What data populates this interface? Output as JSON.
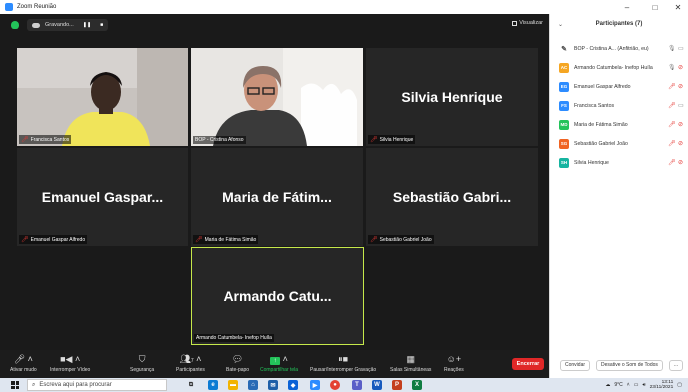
{
  "window": {
    "title": "Zoom Reunião",
    "controls": [
      "–",
      "□",
      "✕"
    ]
  },
  "topbar": {
    "recording": "Gravando...",
    "pause": "❚❚",
    "stop": "■",
    "view_button": "Visualizar"
  },
  "tiles": [
    {
      "name_display": "",
      "label": "Francisca Santos",
      "muted": true,
      "has_video": true
    },
    {
      "name_display": "",
      "label": "BOP - Cristina Afonso",
      "muted": false,
      "has_video": true
    },
    {
      "name_display": "Silvia Henrique",
      "label": "Silvia Henrique",
      "muted": true,
      "has_video": false
    },
    {
      "name_display": "Emanuel Gaspar...",
      "label": "Emanuel Gaspar Alfredo",
      "muted": true,
      "has_video": false
    },
    {
      "name_display": "Maria de Fátim...",
      "label": "Maria de Fátima Simão",
      "muted": true,
      "has_video": false
    },
    {
      "name_display": "Sebastião Gabri...",
      "label": "Sebastião Gabriel João",
      "muted": true,
      "has_video": false
    },
    {
      "name_display": "Armando Catu...",
      "label": "Armando Catumbela- Inefop Huíla",
      "muted": false,
      "has_video": false,
      "active": true
    }
  ],
  "toolbar": {
    "unmute": "Ativar mudo",
    "stop_video": "Interromper Vídeo",
    "security": "Segurança",
    "participants": "Participantes",
    "participants_count": "7",
    "chat": "Bate-papo",
    "share": "Compartilhar tela",
    "record": "Pausar/Interromper Gravação",
    "breakout": "Salas Simultâneas",
    "reactions": "Reações",
    "end": "Encerrar"
  },
  "panel": {
    "title": "Participantes (7)",
    "participants": [
      {
        "initials": "",
        "name": "BOP - Cristina A... (Anfitrião, eu)",
        "color": "#ffffff",
        "host": true
      },
      {
        "initials": "AC",
        "name": "Armando Catumbela- Inefop Huíla",
        "color": "#f5a623"
      },
      {
        "initials": "EG",
        "name": "Emanuel Gaspar Alfredo",
        "color": "#2d8cff"
      },
      {
        "initials": "FS",
        "name": "Francisca Santos",
        "color": "#2d8cff"
      },
      {
        "initials": "MD",
        "name": "Maria de Fátima Simão",
        "color": "#23c35a"
      },
      {
        "initials": "SG",
        "name": "Sebastião Gabriel João",
        "color": "#f06423"
      },
      {
        "initials": "SH",
        "name": "Silvia Henrique",
        "color": "#16b4a0"
      }
    ],
    "invite": "Convidar",
    "mute_all": "Desative o Som de Todos",
    "more": "..."
  },
  "taskbar": {
    "search_placeholder": "Escreva aqui para procurar",
    "temperature": "9°C",
    "time": "13:11",
    "date": "23/11/2021"
  }
}
